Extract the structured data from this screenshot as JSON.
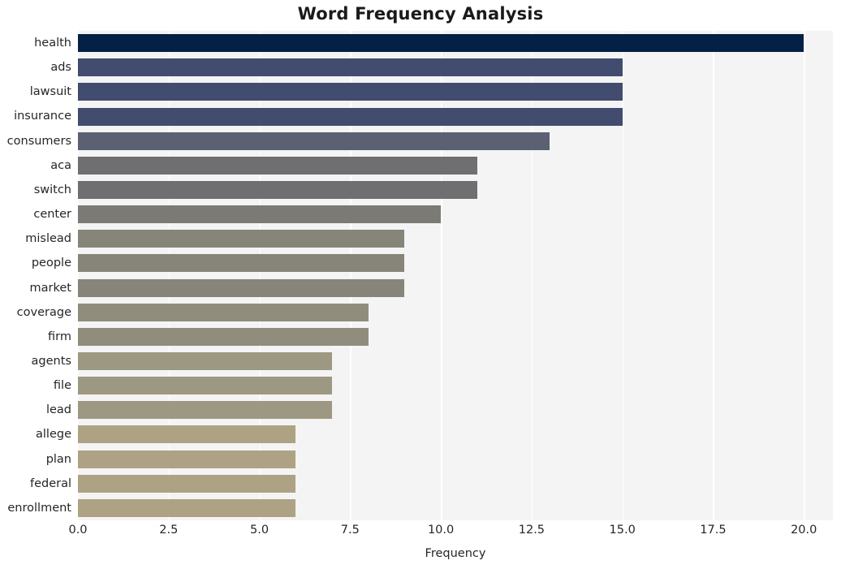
{
  "chart_data": {
    "type": "bar",
    "orientation": "horizontal",
    "title": "Word Frequency Analysis",
    "xlabel": "Frequency",
    "ylabel": "",
    "xlim": [
      0,
      20.8
    ],
    "xticks": [
      "0.0",
      "2.5",
      "5.0",
      "7.5",
      "10.0",
      "12.5",
      "15.0",
      "17.5",
      "20.0"
    ],
    "xtick_values": [
      0,
      2.5,
      5,
      7.5,
      10,
      12.5,
      15,
      17.5,
      20
    ],
    "grid": "vertical-white-on-gray",
    "legend": "none",
    "categories": [
      "health",
      "ads",
      "lawsuit",
      "insurance",
      "consumers",
      "aca",
      "switch",
      "center",
      "mislead",
      "people",
      "market",
      "coverage",
      "firm",
      "agents",
      "file",
      "lead",
      "allege",
      "plan",
      "federal",
      "enrollment"
    ],
    "values": [
      20,
      15,
      15,
      15,
      13,
      11,
      11,
      10,
      9,
      9,
      9,
      8,
      8,
      7,
      7,
      7,
      6,
      6,
      6,
      6
    ],
    "bar_colors": [
      "#042044",
      "#414c६e",
      "#414c6e",
      "#414c6e",
      "#5b6073",
      "#6f6f71",
      "#6f6f71",
      "#7b7a75",
      "#87857a",
      "#87857a",
      "#87857a",
      "#918d7d",
      "#918d7d",
      "#9d9881",
      "#9d9881",
      "#9d9881",
      "#ada384",
      "#ada384",
      "#ada384",
      "#ada384"
    ],
    "plot_background": "#f4f4f5",
    "gridline_color": "#ffffff",
    "text_color": "#262626"
  }
}
